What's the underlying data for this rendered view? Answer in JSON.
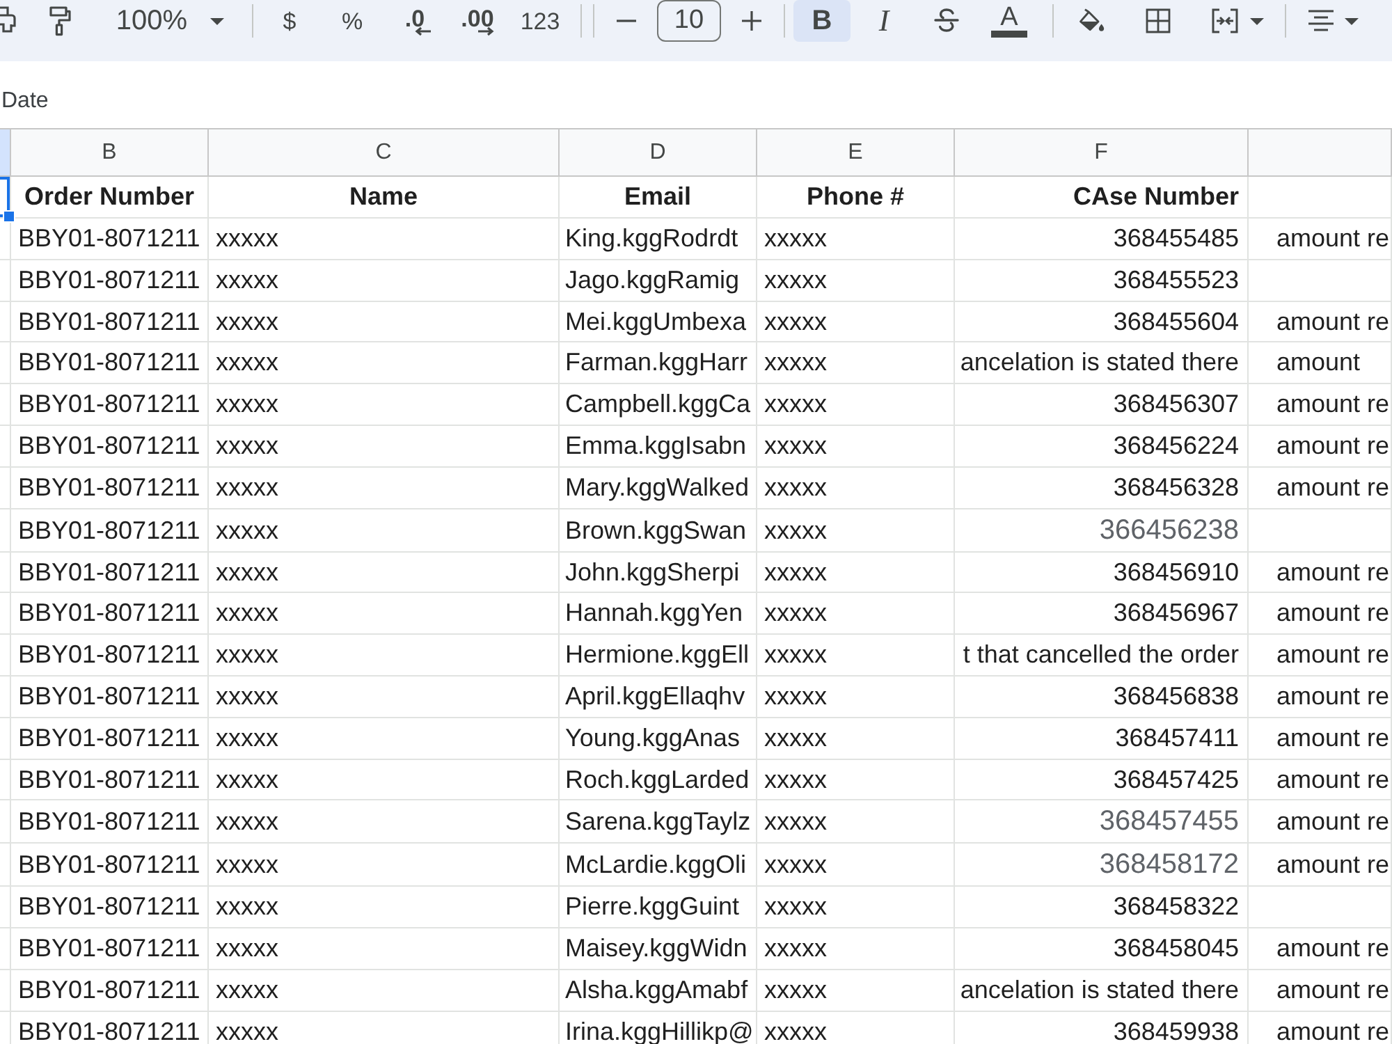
{
  "toolbar": {
    "zoom": "100%",
    "number_formats": [
      {
        "kind": "label",
        "label": "$"
      },
      {
        "kind": "label",
        "label": "%"
      },
      {
        "kind": "decrease",
        "label": ".0"
      },
      {
        "kind": "increase",
        "label": ".00"
      },
      {
        "kind": "label",
        "label": "123"
      }
    ],
    "font_size": "10",
    "bold": {
      "label": "B",
      "selected": true
    },
    "italic": {
      "label": "I",
      "selected": false
    },
    "text_color": {
      "label": "A"
    }
  },
  "formula_bar": {
    "value": "Date"
  },
  "columns": [
    {
      "selected": true
    },
    {
      "letter": "B",
      "selected": false
    },
    {
      "letter": "C",
      "selected": false
    },
    {
      "letter": "D",
      "selected": false
    },
    {
      "letter": "E",
      "selected": false
    },
    {
      "letter": "F",
      "selected": false
    },
    {
      "selected": false
    }
  ],
  "header_row": [
    {
      "selected": true
    },
    {
      "text": "Order Number",
      "selected": false
    },
    {
      "text": "Name",
      "selected": false
    },
    {
      "text": "Email",
      "selected": false
    },
    {
      "text": "Phone #",
      "selected": false
    },
    {
      "text": "CAse Number",
      "selected": false
    },
    {
      "selected": false
    }
  ],
  "rows": [
    {
      "order_number": "BBY01-8071211",
      "name": "xxxxx",
      "email": "King.kggRodrdt",
      "phone": "xxxxx",
      "case_number": "368455485",
      "faded": false,
      "column_g": "amount re"
    },
    {
      "order_number": "BBY01-8071211",
      "name": "xxxxx",
      "email": "Jago.kggRamig",
      "phone": "xxxxx",
      "case_number": "368455523",
      "faded": false
    },
    {
      "order_number": "BBY01-8071211",
      "name": "xxxxx",
      "email": "Mei.kggUmbexa",
      "phone": "xxxxx",
      "case_number": "368455604",
      "faded": false,
      "column_g": "amount re"
    },
    {
      "order_number": "BBY01-8071211",
      "name": "xxxxx",
      "email": "Farman.kggHarr",
      "phone": "xxxxx",
      "case_number": "ancelation is stated there",
      "faded": false,
      "column_g": "amount"
    },
    {
      "order_number": "BBY01-8071211",
      "name": "xxxxx",
      "email": "Campbell.kggCa",
      "phone": "xxxxx",
      "case_number": "368456307",
      "faded": false,
      "column_g": "amount re"
    },
    {
      "order_number": "BBY01-8071211",
      "name": "xxxxx",
      "email": "Emma.kggIsabn",
      "phone": "xxxxx",
      "case_number": "368456224",
      "faded": false,
      "column_g": "amount re"
    },
    {
      "order_number": "BBY01-8071211",
      "name": "xxxxx",
      "email": "Mary.kggWalked",
      "phone": "xxxxx",
      "case_number": "368456328",
      "faded": false,
      "column_g": "amount re"
    },
    {
      "order_number": "BBY01-8071211",
      "name": "xxxxx",
      "email": "Brown.kggSwan",
      "phone": "xxxxx",
      "case_number": "366456238",
      "faded": true
    },
    {
      "order_number": "BBY01-8071211",
      "name": "xxxxx",
      "email": "John.kggSherpi",
      "phone": "xxxxx",
      "case_number": "368456910",
      "faded": false,
      "column_g": "amount re"
    },
    {
      "order_number": "BBY01-8071211",
      "name": "xxxxx",
      "email": "Hannah.kggYen",
      "phone": "xxxxx",
      "case_number": "368456967",
      "faded": false,
      "column_g": "amount re"
    },
    {
      "order_number": "BBY01-8071211",
      "name": "xxxxx",
      "email": "Hermione.kggEll",
      "phone": "xxxxx",
      "case_number": "t that cancelled the order",
      "faded": false,
      "column_g": "amount re"
    },
    {
      "order_number": "BBY01-8071211",
      "name": "xxxxx",
      "email": "April.kggEllaqhv",
      "phone": "xxxxx",
      "case_number": "368456838",
      "faded": false,
      "column_g": "amount re"
    },
    {
      "order_number": "BBY01-8071211",
      "name": "xxxxx",
      "email": "Young.kggAnas",
      "phone": "xxxxx",
      "case_number": "368457411",
      "faded": false,
      "column_g": "amount re"
    },
    {
      "order_number": "BBY01-8071211",
      "name": "xxxxx",
      "email": "Roch.kggLarded",
      "phone": "xxxxx",
      "case_number": "368457425",
      "faded": false,
      "column_g": "amount re"
    },
    {
      "order_number": "BBY01-8071211",
      "name": "xxxxx",
      "email": "Sarena.kggTaylz",
      "phone": "xxxxx",
      "case_number": "368457455",
      "faded": true,
      "column_g": "amount re"
    },
    {
      "order_number": "BBY01-8071211",
      "name": "xxxxx",
      "email": "McLardie.kggOli",
      "phone": "xxxxx",
      "case_number": "368458172",
      "faded": true,
      "column_g": "amount re"
    },
    {
      "order_number": "BBY01-8071211",
      "name": "xxxxx",
      "email": "Pierre.kggGuint",
      "phone": "xxxxx",
      "case_number": "368458322",
      "faded": false
    },
    {
      "order_number": "BBY01-8071211",
      "name": "xxxxx",
      "email": "Maisey.kggWidn",
      "phone": "xxxxx",
      "case_number": "368458045",
      "faded": false,
      "column_g": "amount re"
    },
    {
      "order_number": "BBY01-8071211",
      "name": "xxxxx",
      "email": "Alsha.kggAmabf",
      "phone": "xxxxx",
      "case_number": "ancelation is stated there",
      "faded": false,
      "column_g": "amount re"
    },
    {
      "order_number": "BBY01-8071211",
      "name": "xxxxx",
      "email": "Irina.kggHillikp@",
      "phone": "xxxxx",
      "case_number": "368459938",
      "faded": false,
      "column_g": "amount re"
    }
  ]
}
